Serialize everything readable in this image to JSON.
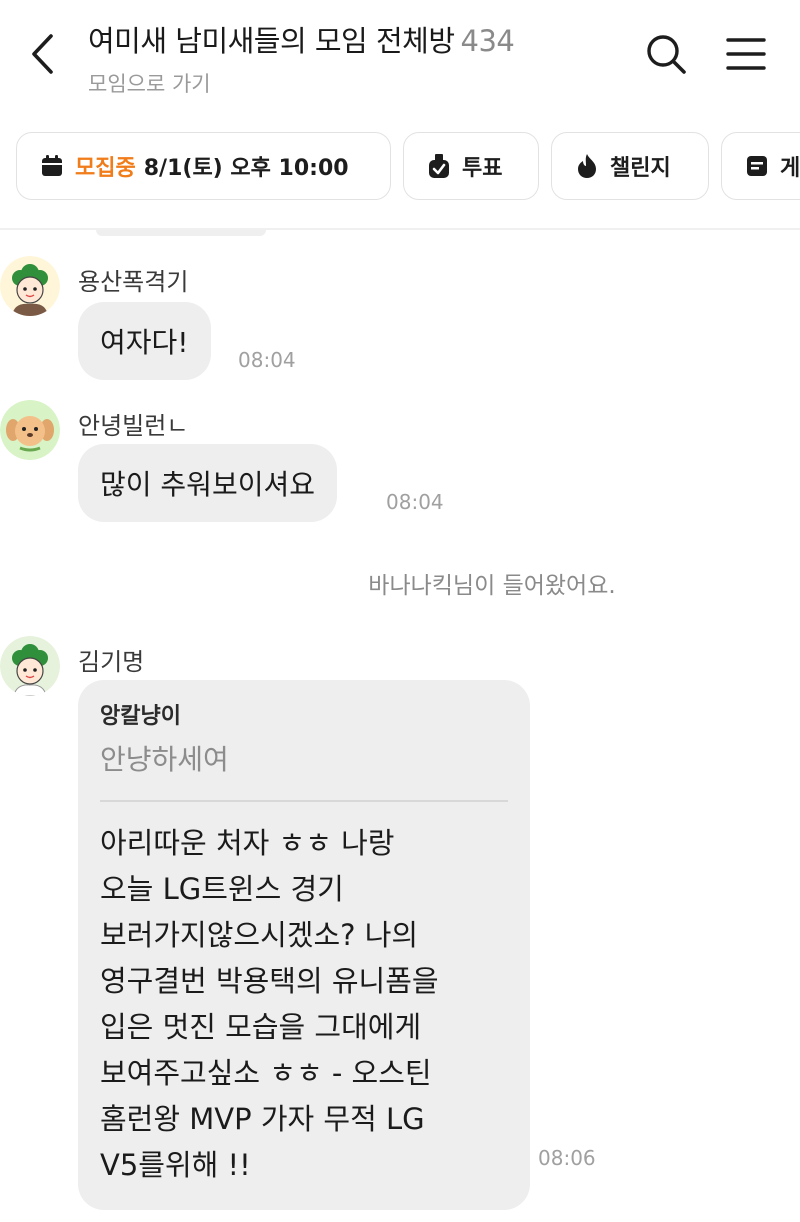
{
  "header": {
    "title": "여미새 남미새들의 모임 전체방",
    "member_count": "434",
    "subtitle": "모임으로 가기"
  },
  "chips": [
    {
      "icon": "calendar-icon",
      "accent": "모집중",
      "label": "8/1(토) 오후 10:00"
    },
    {
      "icon": "vote-icon",
      "label": "투표"
    },
    {
      "icon": "flame-icon",
      "label": "챌린지"
    },
    {
      "icon": "board-icon",
      "label": "게"
    }
  ],
  "messages": [
    {
      "sender": "용산폭격기",
      "text": "여자다!",
      "time": "08:04"
    },
    {
      "sender": "안녕빌런ㄴ",
      "text": "많이 추워보이셔요",
      "time": "08:04"
    }
  ],
  "system_message": "바나나킥님이 들어왔어요.",
  "reply_message": {
    "sender": "김기명",
    "quoted_name": "앙칼냥이",
    "quoted_text": "안냥하세여",
    "lines": [
      "아리따운 처자 ㅎㅎ 나랑",
      "오늘 LG트윈스 경기",
      "보러가지않으시겠소? 나의",
      "영구결번 박용택의 유니폼을",
      "입은 멋진 모습을 그대에게",
      "보여주고싶소 ㅎㅎ - 오스틴",
      "홈런왕 MVP 가자 무적 LG",
      "V5를위해 !!"
    ],
    "time": "08:06"
  },
  "colors": {
    "accent": "#f07c1a",
    "bubble": "#eeeeee",
    "avatar_green": "#2f8f3a"
  }
}
